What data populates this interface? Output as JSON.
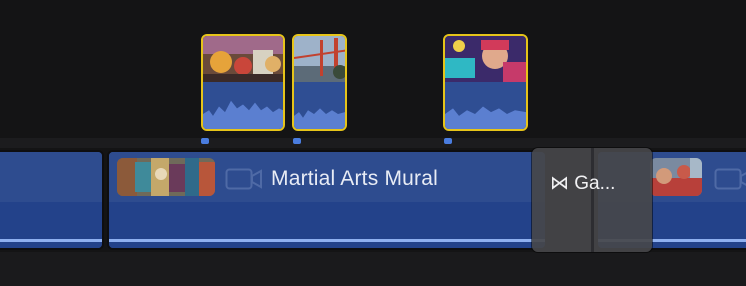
{
  "timeline": {
    "primary_clips": [
      {
        "name": ""
      },
      {
        "name": "Martial Arts Mural"
      },
      {
        "name": ""
      }
    ],
    "connected_clips": [
      {
        "thumbnail": "festival-lion-dance"
      },
      {
        "thumbnail": "golden-gate-bridge"
      },
      {
        "thumbnail": "mural-figure"
      }
    ],
    "transition": {
      "label": "⋈ Ga..."
    }
  },
  "colors": {
    "background": "#141415",
    "clip_blue": "#2f4f94",
    "selection_yellow": "#e6c419",
    "marker_blue": "#4a7de0"
  }
}
